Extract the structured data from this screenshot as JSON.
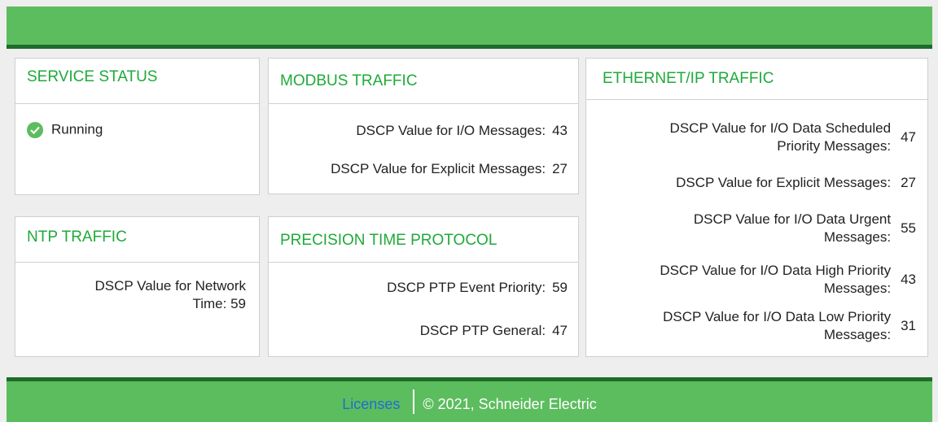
{
  "service_status": {
    "title": "SERVICE STATUS",
    "state": "Running"
  },
  "modbus": {
    "title": "MODBUS TRAFFIC",
    "io_label": "DSCP Value for I/O Messages:",
    "io_value": "43",
    "explicit_label": "DSCP Value for Explicit Messages:",
    "explicit_value": "27"
  },
  "ethernet_ip": {
    "title": "ETHERNET/IP TRAFFIC",
    "rows": [
      {
        "label_line1": "DSCP Value for I/O Data Scheduled",
        "label_line2": "Priority Messages:",
        "value": "47"
      },
      {
        "label_line1": "DSCP Value for Explicit Messages:",
        "label_line2": "",
        "value": "27"
      },
      {
        "label_line1": "DSCP Value for I/O Data Urgent",
        "label_line2": "Messages:",
        "value": "55"
      },
      {
        "label_line1": "DSCP Value for I/O Data High Priority",
        "label_line2": "Messages:",
        "value": "43"
      },
      {
        "label_line1": "DSCP Value for I/O Data Low Priority",
        "label_line2": "Messages:",
        "value": "31"
      }
    ]
  },
  "ntp": {
    "title": "NTP TRAFFIC",
    "label_line1": "DSCP Value for Network",
    "label_line2": "Time: 59"
  },
  "ptp": {
    "title": "PRECISION TIME PROTOCOL",
    "event_label": "DSCP PTP Event Priority:",
    "event_value": "59",
    "general_label": "DSCP PTP General:",
    "general_value": "47"
  },
  "footer": {
    "licenses": "Licenses",
    "copyright": "© 2021, Schneider Electric"
  },
  "colors": {
    "header": "#5cbd5e",
    "header_border": "#1f6b2b",
    "title_text": "#1faa3a",
    "link": "#1e6fcf"
  }
}
